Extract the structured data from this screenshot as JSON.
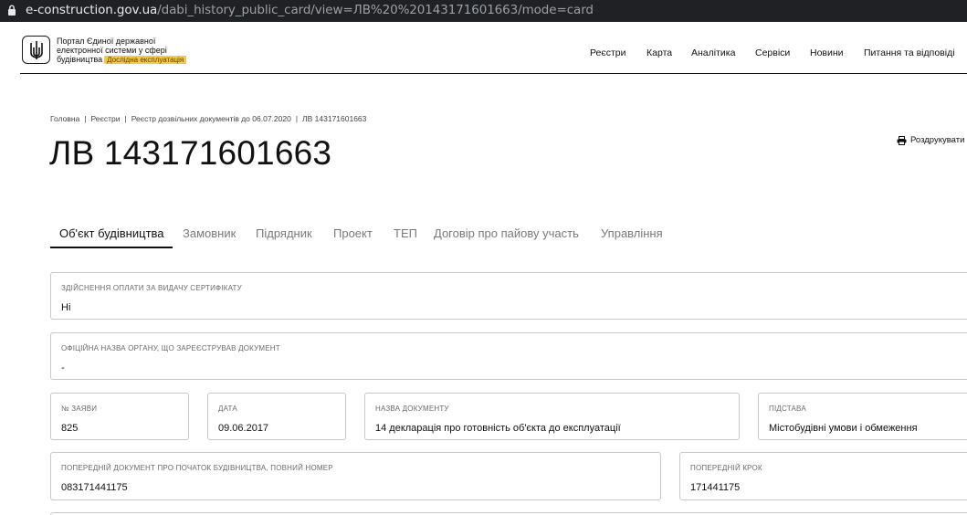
{
  "browser": {
    "url_host": "e-construction.gov.ua",
    "url_path": "/dabi_history_public_card/view=ЛВ%20%20143171601663/mode=card"
  },
  "header": {
    "logo_line1": "Портал Єдиної державної",
    "logo_line2": "електронної системи у сфері",
    "logo_line3": "будівництва",
    "beta_badge": "Дослідна експлуатація",
    "nav": [
      "Реєстри",
      "Карта",
      "Аналітика",
      "Сервіси",
      "Новини",
      "Питання та відповіді"
    ]
  },
  "breadcrumb": [
    "Головна",
    "Реєстри",
    "Реєстр дозвільних документів до 06.07.2020",
    "ЛВ 143171601663"
  ],
  "page": {
    "title": "ЛВ 143171601663",
    "print_label": "Роздрукувати"
  },
  "tabs": [
    "Об'єкт будівництва",
    "Замовник",
    "Підрядник",
    "Проект",
    "ТЕП",
    "Договір про пайову участь",
    "Управління"
  ],
  "fields": {
    "payment": {
      "label": "Здійснення оплати за видачу сертифікату",
      "value": "Ні"
    },
    "authority": {
      "label": "Офіційна назва органу, що зареєстрував документ",
      "value": "-"
    },
    "application_no": {
      "label": "№ заяви",
      "value": "825"
    },
    "date": {
      "label": "Дата",
      "value": "09.06.2017"
    },
    "doc_name": {
      "label": "Назва документу",
      "value": "14 декларація про готовність об'єкта до експлуатації"
    },
    "basis": {
      "label": "Підстава",
      "value": "Містобудівні умови і обмеження"
    },
    "prev_doc": {
      "label": "Попередній документ про початок будівництва, повний номер",
      "value": "083171441175"
    },
    "prev_step": {
      "label": "Попередній крок",
      "value": "171441175"
    }
  },
  "colors": {
    "accent": "#111111",
    "badge": "#f2c94c",
    "border": "#c8c8c8",
    "inactive_tab": "#7a7a7a"
  }
}
